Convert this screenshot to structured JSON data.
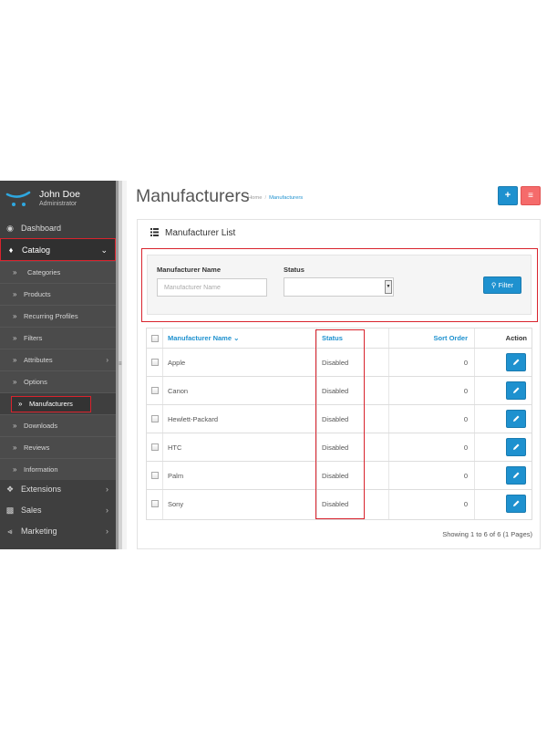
{
  "user": {
    "name": "John Doe",
    "role": "Administrator"
  },
  "nav": {
    "dashboard": "Dashboard",
    "catalog": "Catalog",
    "catalog_items": [
      "Categories",
      "Products",
      "Recurring Profiles",
      "Filters",
      "Attributes",
      "Options",
      "Manufacturers",
      "Downloads",
      "Reviews",
      "Information"
    ],
    "extensions": "Extensions",
    "sales": "Sales",
    "marketing": "Marketing",
    "active_item": "Manufacturers"
  },
  "header": {
    "title": "Manufacturers",
    "breadcrumb": [
      "Home",
      "Manufacturers"
    ]
  },
  "panel": {
    "title": "Manufacturer List"
  },
  "filter": {
    "name_label": "Manufacturer Name",
    "name_placeholder": "Manufacturer Name",
    "name_value": "",
    "status_label": "Status",
    "status_value": "",
    "button_label": "Filter"
  },
  "table": {
    "columns": {
      "name": "Manufacturer Name",
      "status": "Status",
      "sort_order": "Sort Order",
      "action": "Action"
    },
    "rows": [
      {
        "name": "Apple",
        "status": "Disabled",
        "sort_order": "0"
      },
      {
        "name": "Canon",
        "status": "Disabled",
        "sort_order": "0"
      },
      {
        "name": "Hewlett-Packard",
        "status": "Disabled",
        "sort_order": "0"
      },
      {
        "name": "HTC",
        "status": "Disabled",
        "sort_order": "0"
      },
      {
        "name": "Palm",
        "status": "Disabled",
        "sort_order": "0"
      },
      {
        "name": "Sony",
        "status": "Disabled",
        "sort_order": "0"
      }
    ]
  },
  "pagination": {
    "text": "Showing 1 to 6 of 6 (1 Pages)"
  },
  "colors": {
    "primary": "#1e91cf",
    "danger": "#f56b6b",
    "highlight": "#d9232d",
    "sidebar": "#3f3f3f"
  },
  "icons": {
    "logo": "opencart-cart-icon",
    "add": "plus-icon",
    "delete": "trash-icon",
    "filter": "search-icon",
    "edit": "pencil-icon",
    "sort": "chevron-down-icon",
    "list": "list-icon"
  }
}
